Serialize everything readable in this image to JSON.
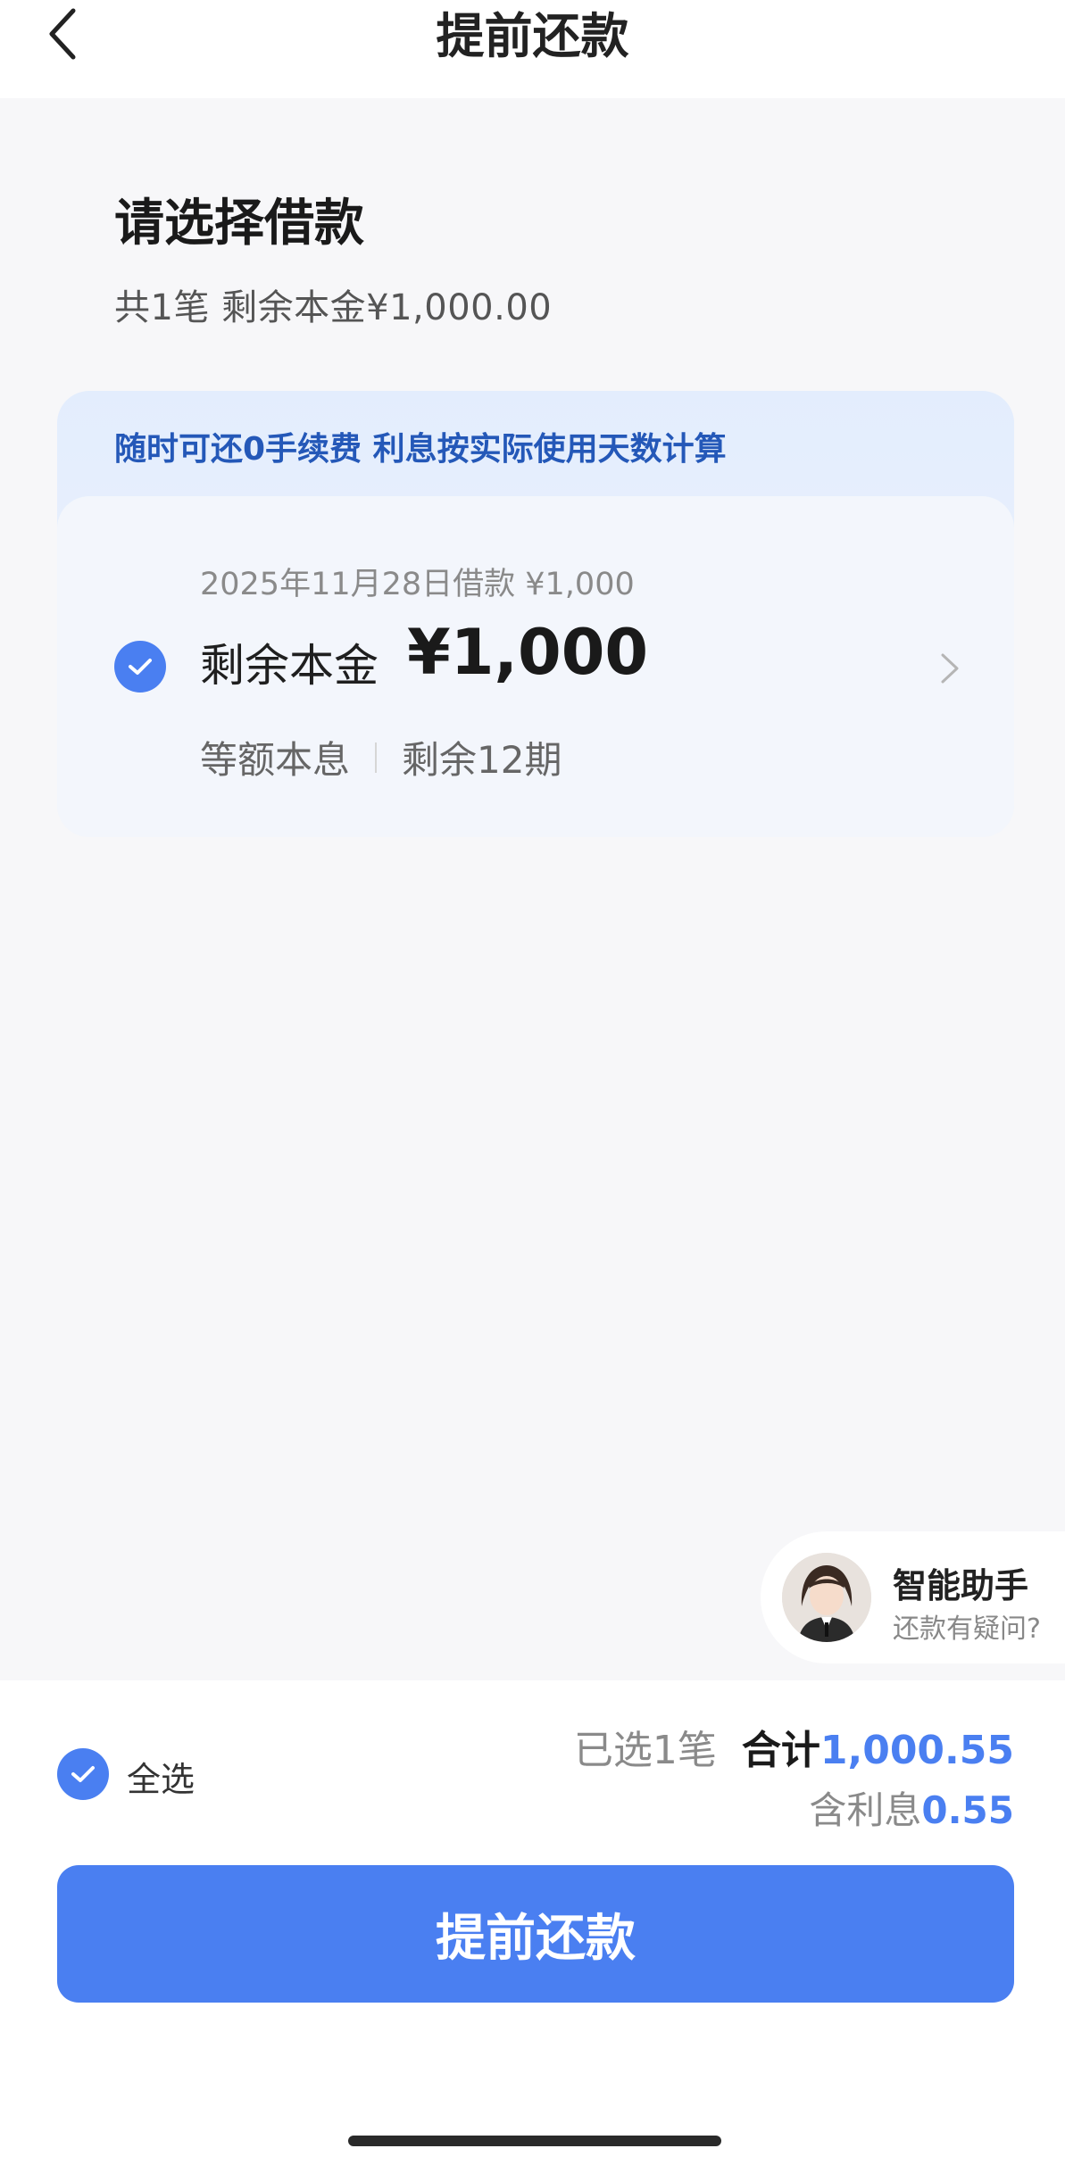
{
  "header": {
    "title": "提前还款",
    "back_icon": "chevron-left-icon"
  },
  "selection": {
    "title": "请选择借款",
    "summary": "共1笔  剩余本金¥1,000.00"
  },
  "loan_card": {
    "banner": "随时可还0手续费  利息按实际使用天数计算",
    "loan_date": "2025年11月28日借款  ¥1,000",
    "remaining_label": "剩余本金",
    "remaining_amount": "¥1,000",
    "repayment_method": "等额本息",
    "remaining_terms": "剩余12期",
    "selected": true
  },
  "assistant": {
    "title": "智能助手",
    "subtitle": "还款有疑问?"
  },
  "footer": {
    "select_all_label": "全选",
    "selected_count": "已选1笔",
    "total_label": "合计",
    "total_value": "1,000.55",
    "interest_label": "含利息",
    "interest_value": "0.55",
    "cta_label": "提前还款"
  },
  "colors": {
    "accent": "#4a7ff1",
    "banner_text": "#2458b8"
  }
}
